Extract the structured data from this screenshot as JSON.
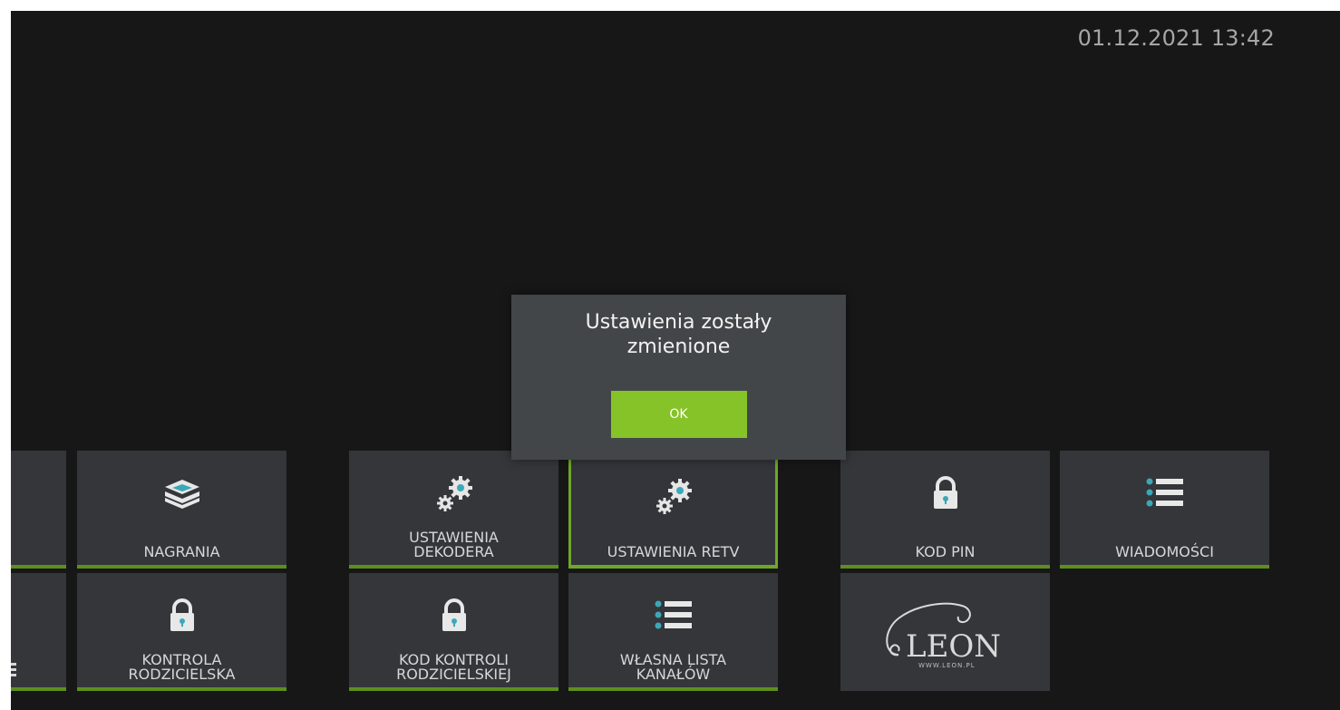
{
  "header": {
    "datetime": "01.12.2021 13:42"
  },
  "dialog": {
    "message": "Ustawienia zostały zmienione",
    "ok_label": "OK"
  },
  "tiles": {
    "nagrania": "NAGRANIA",
    "ustawienia_dekodera": "USTAWIENIA\nDEKODERA",
    "ustawienia_retv": "USTAWIENIA RETV",
    "kod_pin": "KOD PIN",
    "wiadomosci": "WIADOMOŚCI",
    "kontrola_rodzicielska": "KONTROLA\nRODZICIELSKA",
    "kod_kontroli": "KOD KONTROLI\nRODZICIELSKIEJ",
    "wlasna_lista": "WŁASNA LISTA\nKANAŁÓW"
  },
  "logo": {
    "brand": "LEON",
    "url": "WWW.LEON.PL"
  },
  "colors": {
    "background": "#171717",
    "tile": "#34363a",
    "accent_green": "#86c328",
    "underline_green": "#5d8f1d",
    "dialog": "#434648",
    "icon_teal": "#3aa8b8"
  }
}
